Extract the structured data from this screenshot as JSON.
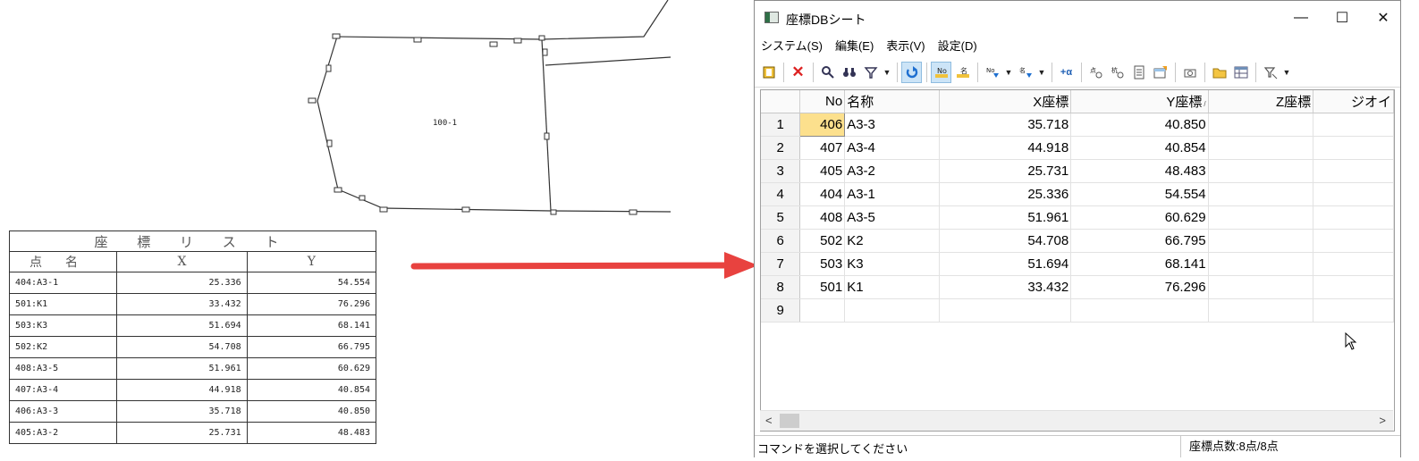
{
  "drawing": {
    "parcel_label": "100-1",
    "list_title": "座 標 リ ス ト",
    "list_headers": [
      "点名",
      "X",
      "Y"
    ],
    "list_rows": [
      [
        "404:A3-1",
        "25.336",
        "54.554"
      ],
      [
        "501:K1",
        "33.432",
        "76.296"
      ],
      [
        "503:K3",
        "51.694",
        "68.141"
      ],
      [
        "502:K2",
        "54.708",
        "66.795"
      ],
      [
        "408:A3-5",
        "51.961",
        "60.629"
      ],
      [
        "407:A3-4",
        "44.918",
        "40.854"
      ],
      [
        "406:A3-3",
        "35.718",
        "40.850"
      ],
      [
        "405:A3-2",
        "25.731",
        "48.483"
      ]
    ]
  },
  "arrow_color": "#e8423f",
  "window": {
    "title": "座標DBシート",
    "controls": {
      "minimize": "—",
      "maximize": "☐",
      "close": "✕"
    },
    "menu": [
      "システム(S)",
      "編集(E)",
      "表示(V)",
      "設定(D)"
    ],
    "toolbar_icons": [
      "book-icon",
      "delete-icon",
      "search-icon",
      "binoculars-icon",
      "filter-icon",
      "dropdown-arrow",
      "refresh-icon",
      "number-icon",
      "name-sort-icon",
      "number-down-icon",
      "dropdown-arrow",
      "name-down-icon",
      "dropdown-arrow",
      "plus-alpha-icon",
      "coord-icon",
      "calc-icon",
      "document-icon",
      "table-export-icon",
      "camera-icon",
      "folder-icon",
      "grid-icon",
      "filter-clear-icon",
      "dropdown-arrow"
    ],
    "columns": [
      "No",
      "名称",
      "X座標",
      "Y座標",
      "Z座標",
      "ジオイ"
    ],
    "sort_indicator": "/",
    "rows": [
      {
        "idx": "1",
        "no": "406",
        "name": "A3-3",
        "x": "35.718",
        "y": "40.850"
      },
      {
        "idx": "2",
        "no": "407",
        "name": "A3-4",
        "x": "44.918",
        "y": "40.854"
      },
      {
        "idx": "3",
        "no": "405",
        "name": "A3-2",
        "x": "25.731",
        "y": "48.483"
      },
      {
        "idx": "4",
        "no": "404",
        "name": "A3-1",
        "x": "25.336",
        "y": "54.554"
      },
      {
        "idx": "5",
        "no": "408",
        "name": "A3-5",
        "x": "51.961",
        "y": "60.629"
      },
      {
        "idx": "6",
        "no": "502",
        "name": "K2",
        "x": "54.708",
        "y": "66.795"
      },
      {
        "idx": "7",
        "no": "503",
        "name": "K3",
        "x": "51.694",
        "y": "68.141"
      },
      {
        "idx": "8",
        "no": "501",
        "name": "K1",
        "x": "33.432",
        "y": "76.296"
      },
      {
        "idx": "9",
        "no": "",
        "name": "",
        "x": "",
        "y": ""
      }
    ],
    "scroll_left": "<",
    "scroll_right": ">",
    "status_left": "コマンドを選択してください",
    "status_right": "座標点数:8点/8点"
  }
}
